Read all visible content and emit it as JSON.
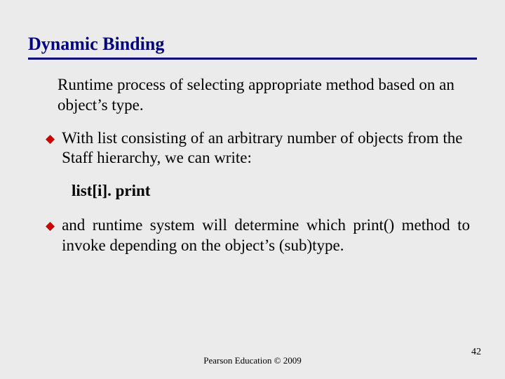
{
  "slide": {
    "title": "Dynamic Binding",
    "lead": "Runtime process of selecting appropriate method based on an object’s type.",
    "bullet1": "With list consisting of an arbitrary number of objects from the Staff hierarchy, we can write:",
    "code": "list[i]. print",
    "bullet2": "and runtime system will determine which print() method to invoke depending on the object’s (sub)type.",
    "footer": "Pearson Education © 2009",
    "page": "42"
  }
}
